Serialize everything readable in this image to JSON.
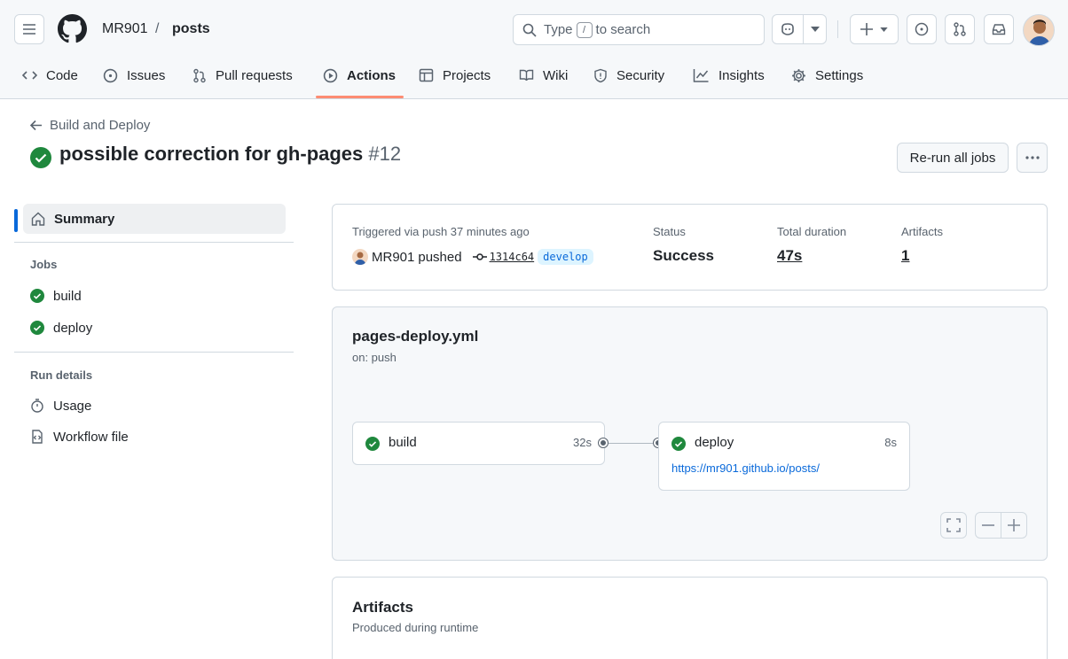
{
  "header": {
    "owner": "MR901",
    "separator": "/",
    "repo": "posts",
    "search": {
      "prefix": "Type",
      "key": "/",
      "suffix": "to search"
    }
  },
  "tabs": [
    {
      "label": "Code",
      "icon": "code-icon"
    },
    {
      "label": "Issues",
      "icon": "issue-icon"
    },
    {
      "label": "Pull requests",
      "icon": "pull-request-icon"
    },
    {
      "label": "Actions",
      "icon": "play-icon",
      "selected": true
    },
    {
      "label": "Projects",
      "icon": "table-icon"
    },
    {
      "label": "Wiki",
      "icon": "book-icon"
    },
    {
      "label": "Security",
      "icon": "shield-icon"
    },
    {
      "label": "Insights",
      "icon": "graph-icon"
    },
    {
      "label": "Settings",
      "icon": "gear-icon"
    }
  ],
  "run": {
    "back_label": "Build and Deploy",
    "title": "possible correction for gh-pages",
    "number": "#12",
    "rerun_label": "Re-run all jobs"
  },
  "sidebar": {
    "summary": "Summary",
    "jobs_heading": "Jobs",
    "jobs": [
      "build",
      "deploy"
    ],
    "details_heading": "Run details",
    "usage": "Usage",
    "workflow_file": "Workflow file"
  },
  "summary_card": {
    "trigger": "Triggered via push 37 minutes ago",
    "actor": "MR901",
    "action": "pushed",
    "commit": "1314c64",
    "branch": "develop",
    "status_label": "Status",
    "status": "Success",
    "duration_label": "Total duration",
    "duration": "47s",
    "artifacts_label": "Artifacts",
    "artifacts": "1"
  },
  "workflow": {
    "file": "pages-deploy.yml",
    "trigger": "on: push",
    "build": {
      "name": "build",
      "time": "32s"
    },
    "deploy": {
      "name": "deploy",
      "time": "8s",
      "url": "https://mr901.github.io/posts/"
    }
  },
  "artifacts_section": {
    "title": "Artifacts",
    "subtitle": "Produced during runtime"
  },
  "colors": {
    "success": "#1f883d",
    "accent": "#0969da",
    "tab_underline": "#fd8c73"
  }
}
